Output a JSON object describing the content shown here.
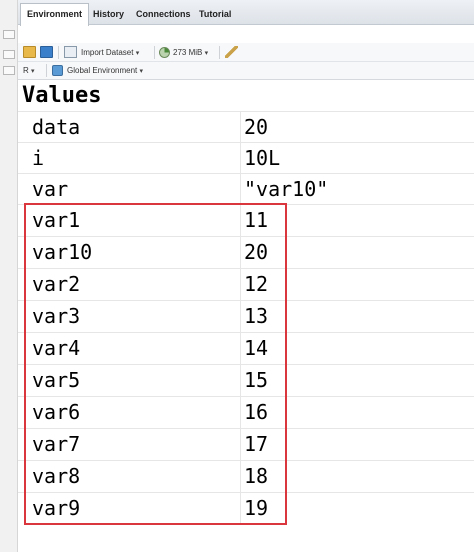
{
  "tabs": [
    {
      "label": "Environment",
      "active": true
    },
    {
      "label": "History",
      "active": false
    },
    {
      "label": "Connections",
      "active": false
    },
    {
      "label": "Tutorial",
      "active": false
    }
  ],
  "toolbar": {
    "import_dataset": "Import Dataset",
    "memory": "273 MiB",
    "language": "R",
    "environment": "Global Environment"
  },
  "section_title": "Values",
  "variables": [
    {
      "name": "data",
      "value": "20"
    },
    {
      "name": "i",
      "value": "10L"
    },
    {
      "name": "var",
      "value": "\"var10\""
    },
    {
      "name": "var1",
      "value": "11"
    },
    {
      "name": "var10",
      "value": "20"
    },
    {
      "name": "var2",
      "value": "12"
    },
    {
      "name": "var3",
      "value": "13"
    },
    {
      "name": "var4",
      "value": "14"
    },
    {
      "name": "var5",
      "value": "15"
    },
    {
      "name": "var6",
      "value": "16"
    },
    {
      "name": "var7",
      "value": "17"
    },
    {
      "name": "var8",
      "value": "18"
    },
    {
      "name": "var9",
      "value": "19"
    }
  ],
  "colors": {
    "highlight": "#d9363e",
    "accent": "#3a7fc9"
  }
}
